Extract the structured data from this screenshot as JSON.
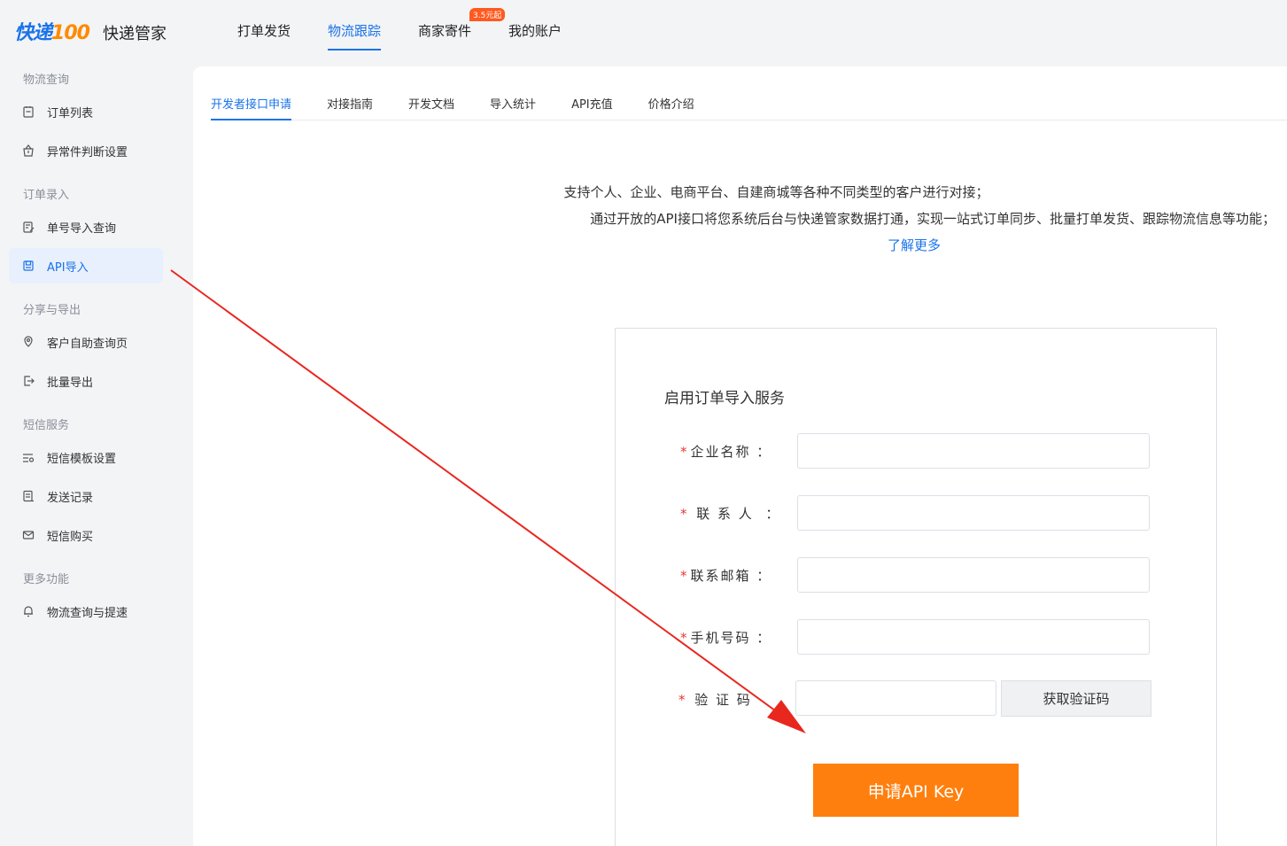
{
  "header": {
    "logo_primary": "快递",
    "logo_secondary": "100",
    "app_name": "快递管家",
    "nav": [
      {
        "label": "打单发货",
        "active": false
      },
      {
        "label": "物流跟踪",
        "active": true
      },
      {
        "label": "商家寄件",
        "active": false,
        "badge": "3.5元起"
      },
      {
        "label": "我的账户",
        "active": false
      }
    ]
  },
  "sidebar": {
    "groups": [
      {
        "title": "物流查询",
        "items": [
          {
            "label": "订单列表",
            "icon": "clipboard-icon"
          },
          {
            "label": "异常件判断设置",
            "icon": "alert-box-icon"
          }
        ]
      },
      {
        "title": "订单录入",
        "items": [
          {
            "label": "单号导入查询",
            "icon": "edit-doc-icon"
          },
          {
            "label": "API导入",
            "icon": "save-icon",
            "active": true
          }
        ]
      },
      {
        "title": "分享与导出",
        "items": [
          {
            "label": "客户自助查询页",
            "icon": "location-icon"
          },
          {
            "label": "批量导出",
            "icon": "export-icon"
          }
        ]
      },
      {
        "title": "短信服务",
        "items": [
          {
            "label": "短信模板设置",
            "icon": "template-settings-icon"
          },
          {
            "label": "发送记录",
            "icon": "record-icon"
          },
          {
            "label": "短信购买",
            "icon": "mail-icon"
          }
        ]
      },
      {
        "title": "更多功能",
        "items": [
          {
            "label": "物流查询与提速",
            "icon": "bell-icon"
          }
        ]
      }
    ]
  },
  "tabs": [
    {
      "label": "开发者接口申请",
      "active": true
    },
    {
      "label": "对接指南"
    },
    {
      "label": "开发文档"
    },
    {
      "label": "导入统计"
    },
    {
      "label": "API充值"
    },
    {
      "label": "价格介绍"
    }
  ],
  "intro": {
    "line1": "支持个人、企业、电商平台、自建商城等各种不同类型的客户进行对接；",
    "line2": "通过开放的API接口将您系统后台与快递管家数据打通，实现一站式订单同步、批量打单发货、跟踪物流信息等功能；",
    "learn_more": "了解更多"
  },
  "form": {
    "title": "启用订单导入服务",
    "required_mark": "*",
    "fields": [
      {
        "label": "企业名称 ：",
        "value": "",
        "placeholder": ""
      },
      {
        "label": " 联 系 人  ：",
        "value": "",
        "placeholder": ""
      },
      {
        "label": "联系邮箱 ：",
        "value": "",
        "placeholder": ""
      },
      {
        "label": "手机号码 ：",
        "value": "",
        "placeholder": ""
      }
    ],
    "code_label": " 验 证 码",
    "code_value": "",
    "get_code_button": "获取验证码",
    "submit_button": "申请API Key"
  },
  "colors": {
    "accent": "#1a73e8",
    "submit": "#ff7f0e",
    "required": "#e53935",
    "arrow": "#e8271f"
  }
}
